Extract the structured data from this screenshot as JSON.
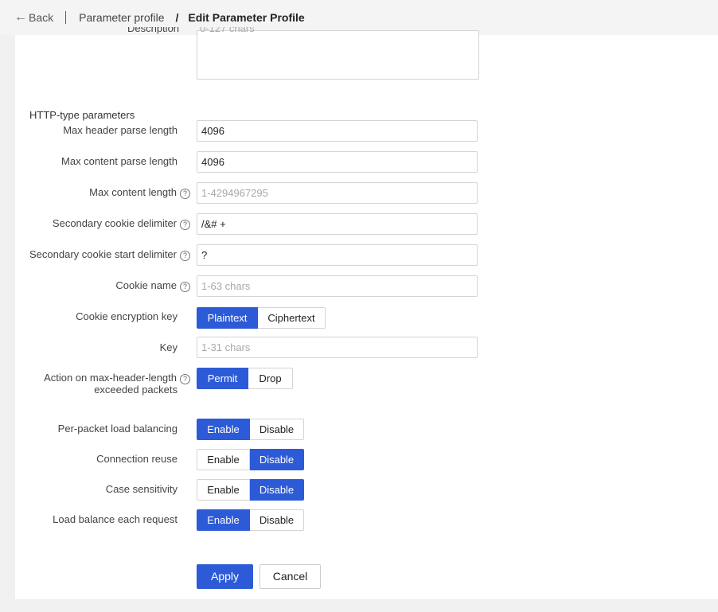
{
  "header": {
    "back_label": "Back",
    "breadcrumb_parent": "Parameter profile",
    "breadcrumb_separator": "/",
    "breadcrumb_current": "Edit Parameter Profile"
  },
  "description": {
    "label": "Description",
    "placeholder": "0-127 chars"
  },
  "section_title": "HTTP-type parameters",
  "fields": {
    "max_header_parse_length": {
      "label": "Max header parse length",
      "value": "4096"
    },
    "max_content_parse_length": {
      "label": "Max content parse length",
      "value": "4096"
    },
    "max_content_length": {
      "label": "Max content length",
      "placeholder": "1-4294967295"
    },
    "secondary_cookie_delimiter": {
      "label": "Secondary cookie delimiter",
      "value": "/&# +"
    },
    "secondary_cookie_start_delimiter": {
      "label": "Secondary cookie start delimiter",
      "value": "?"
    },
    "cookie_name": {
      "label": "Cookie name",
      "placeholder": "1-63 chars"
    },
    "key": {
      "label": "Key",
      "placeholder": "1-31 chars"
    }
  },
  "toggles": {
    "cookie_encryption_key": {
      "label": "Cookie encryption key",
      "options": [
        "Plaintext",
        "Ciphertext"
      ],
      "selected": "Plaintext"
    },
    "action_max_header": {
      "label_line1": "Action on max-header-length",
      "label_line2": "exceeded packets",
      "options": [
        "Permit",
        "Drop"
      ],
      "selected": "Permit"
    },
    "per_packet_lb": {
      "label": "Per-packet load balancing",
      "options": [
        "Enable",
        "Disable"
      ],
      "selected": "Enable"
    },
    "connection_reuse": {
      "label": "Connection reuse",
      "options": [
        "Enable",
        "Disable"
      ],
      "selected": "Disable"
    },
    "case_sensitivity": {
      "label": "Case sensitivity",
      "options": [
        "Enable",
        "Disable"
      ],
      "selected": "Disable"
    },
    "lb_each_request": {
      "label": "Load balance each request",
      "options": [
        "Enable",
        "Disable"
      ],
      "selected": "Enable"
    }
  },
  "help_glyph": "?",
  "actions": {
    "apply": "Apply",
    "cancel": "Cancel"
  },
  "colors": {
    "accent": "#2d5bd7",
    "border": "#d4d4d4",
    "background": "#f0f0f0"
  }
}
